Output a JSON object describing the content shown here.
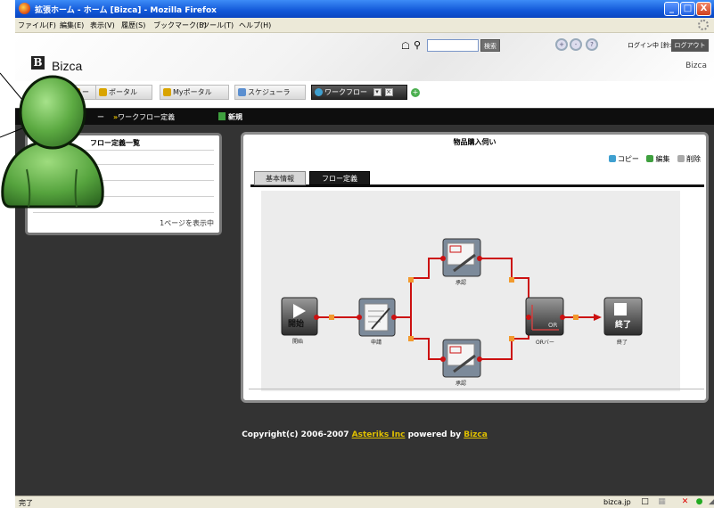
{
  "window": {
    "title": "拡張ホーム - ホーム [Bizca] - Mozilla Firefox",
    "buttons": {
      "minimize": "_",
      "maximize": "□",
      "close": "X"
    }
  },
  "menu": [
    "ファイル(F)",
    "編集(E)",
    "表示(V)",
    "履歴(S)",
    "ブックマーク(B)",
    "ツール(T)",
    "ヘルプ(H)"
  ],
  "header": {
    "logo_letter": "B",
    "logo_text": "Bizca",
    "search_button": "検索",
    "login_status": "ログイン中 [鈴木]",
    "logout_button": "ログアウト",
    "brand": "Bizca"
  },
  "tabs": [
    {
      "label": "ー",
      "color": "#d9a400"
    },
    {
      "label": "ポータル",
      "color": "#d9a400"
    },
    {
      "label": "Myポータル",
      "color": "#d9a400"
    },
    {
      "label": "スケジューラ",
      "color": "#5b8fd0"
    },
    {
      "label": "ワークフロー",
      "color": "#3ea0d0",
      "active": true
    }
  ],
  "toolbar": {
    "crumb_prefix": "ー",
    "crumb_current": "ワークフロー定義",
    "new_label": "新規"
  },
  "left_panel": {
    "title": "フロー定義一覧",
    "status": "1ページを表示中"
  },
  "right_panel": {
    "title": "物品購入伺い",
    "actions": [
      "コピー",
      "編集",
      "削除"
    ],
    "subtabs": [
      "基本情報",
      "フロー定義"
    ],
    "active_subtab": "フロー定義"
  },
  "workflow": {
    "nodes": [
      {
        "id": "start",
        "label": "開始",
        "text": "開始"
      },
      {
        "id": "apply",
        "label": "申請"
      },
      {
        "id": "approve1",
        "label": "承認"
      },
      {
        "id": "approve2",
        "label": "承認"
      },
      {
        "id": "or",
        "label": "ORバー",
        "text": "OR"
      },
      {
        "id": "end",
        "label": "終了",
        "text": "終了"
      }
    ]
  },
  "footer": {
    "copyright": "Copyright(c) 2006-2007 ",
    "company": "Asteriks Inc",
    "powered": " powered by ",
    "product": "Bizca"
  },
  "statusbar": {
    "text": "完了",
    "domain": "bizca.jp"
  },
  "colors": {
    "accent_red": "#cc1111",
    "toolbar_bg": "#0e0e0e",
    "main_bg": "#333333",
    "footer_link": "#e0c000"
  }
}
